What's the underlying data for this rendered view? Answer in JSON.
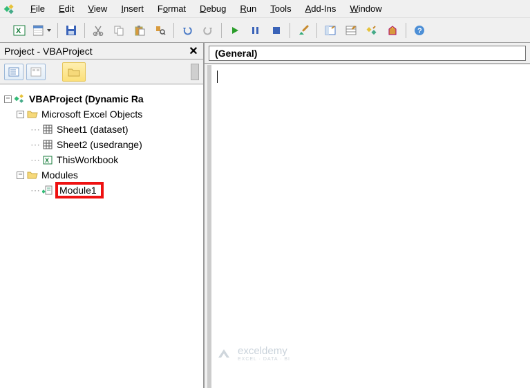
{
  "menu": {
    "items": [
      {
        "label": "File",
        "u": 0
      },
      {
        "label": "Edit",
        "u": 0
      },
      {
        "label": "View",
        "u": 0
      },
      {
        "label": "Insert",
        "u": 0
      },
      {
        "label": "Format",
        "u": 1
      },
      {
        "label": "Debug",
        "u": 0
      },
      {
        "label": "Run",
        "u": 0
      },
      {
        "label": "Tools",
        "u": 0
      },
      {
        "label": "Add-Ins",
        "u": 0
      },
      {
        "label": "Window",
        "u": 0
      }
    ]
  },
  "project_pane": {
    "title": "Project - VBAProject",
    "root": "VBAProject (Dynamic Ra",
    "folder1": "Microsoft Excel Objects",
    "sheet1": "Sheet1 (dataset)",
    "sheet2": "Sheet2 (usedrange)",
    "workbook": "ThisWorkbook",
    "folder2": "Modules",
    "module": "Module1"
  },
  "code": {
    "object_combo": "(General)"
  },
  "watermark": {
    "brand": "exceldemy",
    "tag": "EXCEL · DATA · BI"
  }
}
